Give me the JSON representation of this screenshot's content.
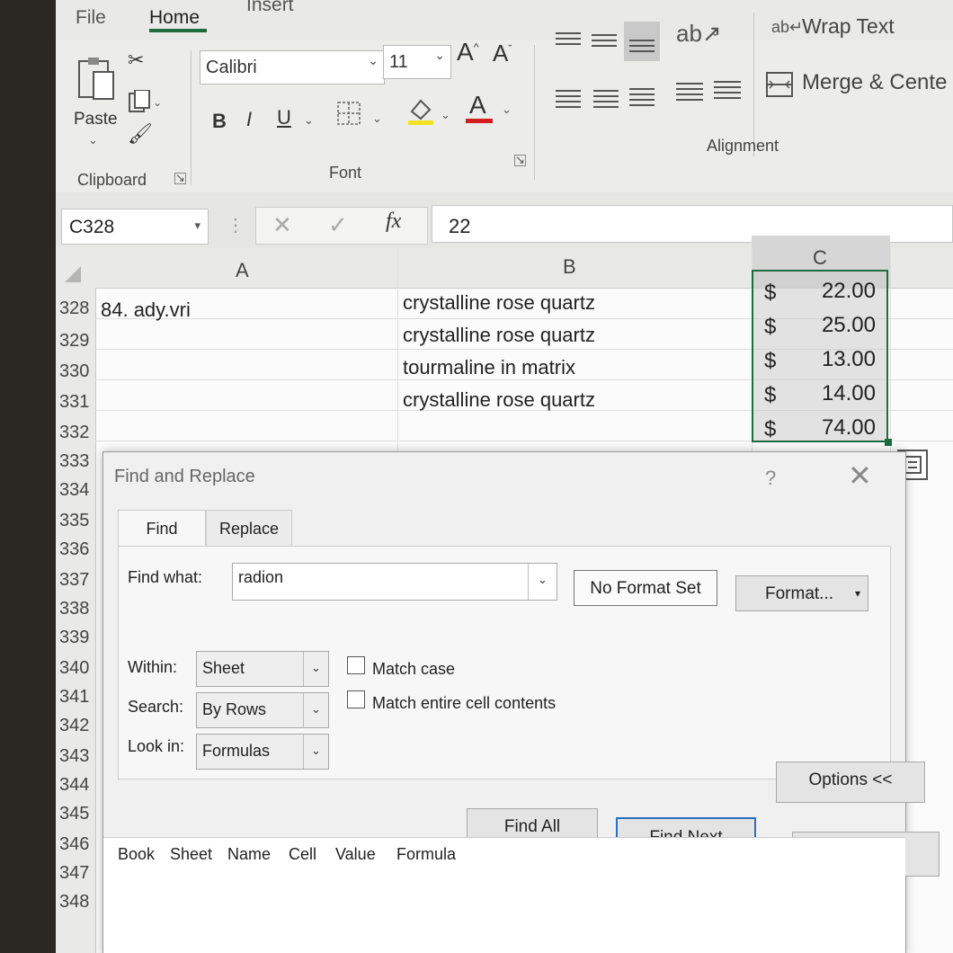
{
  "ribbon": {
    "tabs": [
      "File",
      "Home",
      "Insert"
    ],
    "clipboard": {
      "paste_label": "Paste",
      "group_label": "Clipboard"
    },
    "font": {
      "font_name": "Calibri",
      "font_size": "11",
      "group_label": "Font",
      "bold": "B",
      "italic": "I",
      "underline": "U"
    },
    "alignment": {
      "wrap_text": "Wrap Text",
      "merge_center": "Merge & Cente",
      "group_label": "Alignment"
    }
  },
  "formula_bar": {
    "name_box": "C328",
    "fx": "fx",
    "value": "22"
  },
  "grid": {
    "columns": [
      "A",
      "B",
      "C"
    ],
    "rows": [
      {
        "num": "328",
        "a": "84. ady.vri",
        "b": "crystalline rose quartz",
        "c_symbol": "$",
        "c_amount": "22.00"
      },
      {
        "num": "329",
        "a": "",
        "b": "crystalline rose quartz",
        "c_symbol": "$",
        "c_amount": "25.00"
      },
      {
        "num": "330",
        "a": "",
        "b": "tourmaline in matrix",
        "c_symbol": "$",
        "c_amount": "13.00"
      },
      {
        "num": "331",
        "a": "",
        "b": "crystalline rose quartz",
        "c_symbol": "$",
        "c_amount": "14.00"
      },
      {
        "num": "332",
        "a": "",
        "b": "",
        "c_symbol": "$",
        "c_amount": "74.00"
      }
    ],
    "extra_row_numbers": [
      "333",
      "334",
      "335",
      "336",
      "337",
      "338",
      "339",
      "340",
      "341",
      "342",
      "343",
      "344",
      "345",
      "346",
      "347",
      "348"
    ]
  },
  "dialog": {
    "title": "Find and Replace",
    "help": "?",
    "tabs": {
      "find": "Find",
      "replace": "Replace"
    },
    "find_what_label": "Find what:",
    "find_what_value": "radion",
    "no_format_set": "No Format Set",
    "format_button": "Format...",
    "within_label": "Within:",
    "within_value": "Sheet",
    "search_label": "Search:",
    "search_value": "By Rows",
    "look_in_label": "Look in:",
    "look_in_value": "Formulas",
    "match_case": "Match case",
    "match_entire": "Match entire cell contents",
    "options_button": "Options <<",
    "find_all_button": "Find All",
    "find_next_button": "Find Next",
    "close_button": "Close",
    "result_columns": [
      "Book",
      "Sheet",
      "Name",
      "Cell",
      "Value",
      "Formula"
    ]
  }
}
